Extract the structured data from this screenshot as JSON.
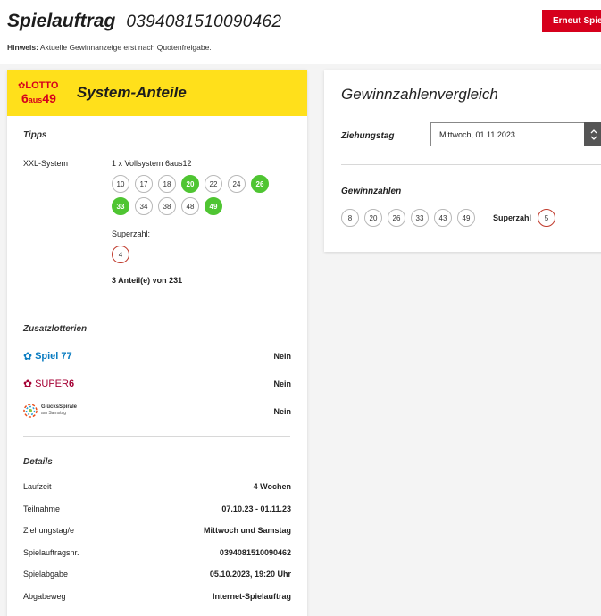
{
  "header": {
    "title": "Spielauftrag",
    "order_number": "0394081510090462",
    "hint_label": "Hinweis:",
    "hint_text": " Aktuelle Gewinnanzeige erst nach Quotenfreigabe.",
    "repeat_button": "Erneut Spiel"
  },
  "left": {
    "logo_top": "LOTTO",
    "logo_bottom_a": "6",
    "logo_bottom_b": "aus",
    "logo_bottom_c": "49",
    "title": "System-Anteile",
    "tipps": {
      "section": "Tipps",
      "label": "XXL-System",
      "system": "1 x Vollsystem 6aus12",
      "numbers_row1": [
        "10",
        "17",
        "18",
        "20",
        "22",
        "24",
        "26"
      ],
      "numbers_row2": [
        "33",
        "34",
        "38",
        "48",
        "49"
      ],
      "superzahl_label": "Superzahl:",
      "superzahl": "4",
      "shares": "3 Anteil(e) von 231"
    },
    "zusatz": {
      "section": "Zusatzlotterien",
      "spiel77_name": "Spiel 77",
      "spiel77_value": "Nein",
      "super6_name_a": "SUPER",
      "super6_name_b": "6",
      "super6_value": "Nein",
      "gs_name_a": "GlücksSpirale",
      "gs_name_b": "am Samstag",
      "gs_value": "Nein"
    },
    "details": {
      "section": "Details",
      "rows": [
        {
          "label": "Laufzeit",
          "value": "4 Wochen"
        },
        {
          "label": "Teilnahme",
          "value": "07.10.23 - 01.11.23"
        },
        {
          "label": "Ziehungstag/e",
          "value": "Mittwoch und Samstag"
        },
        {
          "label": "Spielauftragsnr.",
          "value": "0394081510090462"
        },
        {
          "label": "Spielabgabe",
          "value": "05.10.2023, 19:20 Uhr"
        },
        {
          "label": "Abgabeweg",
          "value": "Internet-Spielauftrag"
        }
      ]
    }
  },
  "right": {
    "title": "Gewinnzahlenvergleich",
    "draw_label": "Ziehungstag",
    "draw_value": "Mittwoch, 01.11.2023",
    "winning_label": "Gewinnzahlen",
    "winning_numbers": [
      "8",
      "20",
      "26",
      "33",
      "43",
      "49"
    ],
    "superzahl_label": "Superzahl",
    "superzahl": "5"
  },
  "colors": {
    "accent_red": "#d6001c",
    "lotto_yellow": "#ffe01b",
    "hit_green": "#4fc532",
    "spiel77_blue": "#0a7cc1",
    "super6_red": "#a50034"
  }
}
